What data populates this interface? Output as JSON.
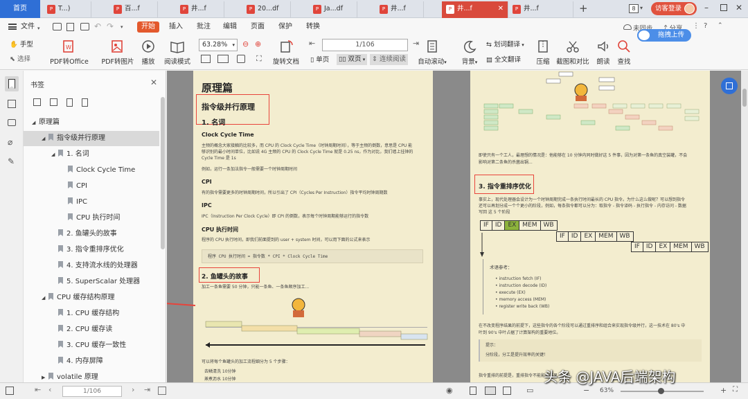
{
  "tabs": {
    "home": "首页",
    "docs": [
      {
        "label": "T...)"
      },
      {
        "label": "百...f"
      },
      {
        "label": "井...f"
      },
      {
        "label": "20...df"
      },
      {
        "label": "Ja...df"
      },
      {
        "label": "井...f"
      },
      {
        "label": "井...f",
        "active": true
      },
      {
        "label": "井...f"
      }
    ],
    "page_count_badge": "8",
    "login": "访客登录"
  },
  "menu": {
    "file": "文件",
    "start": "开始",
    "insert": "插入",
    "annotate": "批注",
    "edit": "编辑",
    "page": "页面",
    "protect": "保护",
    "convert": "转换",
    "sync": "未同步",
    "share": "分享"
  },
  "toolbar": {
    "hand": "手型",
    "select": "选择",
    "pdf_to_office": "PDF转Office",
    "pdf_to_image": "PDF转图片",
    "play": "播放",
    "read_mode": "阅读模式",
    "zoom": "63.28%",
    "rotate": "旋转文档",
    "page_value": "1/106",
    "single": "单页",
    "double": "双页",
    "continuous": "连续阅读",
    "auto_scroll": "自动滚动",
    "background": "背景",
    "word_translate": "划词翻译",
    "full_translate": "全文翻译",
    "compress": "压缩",
    "crop_compare": "截图和对比",
    "read_aloud": "朗读",
    "find": "查找",
    "upload": "拖拽上传"
  },
  "sidebar": {
    "title": "书签",
    "items": [
      {
        "label": "原理篇",
        "level": 0,
        "expanded": true
      },
      {
        "label": "指令级并行原理",
        "level": 1,
        "expanded": true,
        "selected": true
      },
      {
        "label": "1. 名词",
        "level": 2,
        "expanded": true
      },
      {
        "label": "Clock Cycle Time",
        "level": 3
      },
      {
        "label": "CPI",
        "level": 3
      },
      {
        "label": "IPC",
        "level": 3
      },
      {
        "label": "CPU 执行时间",
        "level": 3
      },
      {
        "label": "2. 鱼罐头的故事",
        "level": 2
      },
      {
        "label": "3. 指令重排序优化",
        "level": 2
      },
      {
        "label": "4. 支持流水线的处理器",
        "level": 2
      },
      {
        "label": "5. SuperScalar 处理器",
        "level": 2
      },
      {
        "label": "CPU 缓存结构原理",
        "level": 1,
        "expanded": true
      },
      {
        "label": "1. CPU 缓存结构",
        "level": 2
      },
      {
        "label": "2. CPU 缓存读",
        "level": 2
      },
      {
        "label": "3. CPU 缓存一致性",
        "level": 2
      },
      {
        "label": "4. 内存屏障",
        "level": 2
      },
      {
        "label": "volatile 原理",
        "level": 1,
        "expanded": false
      }
    ]
  },
  "page1": {
    "title": "原理篇",
    "h1": "指令级并行原理",
    "h2_terms": "1. 名词",
    "h3_clock": "Clock Cycle Time",
    "p_clock": "主频的概念大家接触的比较多，而 CPU 的 Clock Cycle Time（时钟周期时间），等于主频的倒数，意思是 CPU 能",
    "p_clock2": "够识别的最小时间单位，比如说 4G 主频的 CPU 的 Clock Cycle Time 就是 0.25 ns，作为对比，我们墙上挂钟的",
    "p_clock3": "Cycle Time 是 1s",
    "p_example": "例如，运行一条加法指令一般需要一个时钟周期时间",
    "h3_cpi": "CPI",
    "p_cpi": "有的指令需要更多的时钟周期时间，所以引出了 CPI（Cycles Per Instruction）指令平均时钟周期数",
    "h3_ipc": "IPC",
    "p_ipc": "IPC（Instruction Per Clock Cycle）即 CPI 的倒数，表示每个时钟周期能够运行的指令数",
    "h3_exec": "CPU 执行时间",
    "p_exec": "程序的 CPU 执行时间，即我们前面提到的 user + system 时间，可以用下面的公式来表示",
    "code": "程序 CPU 执行时间 = 指令数 * CPI * Clock Cycle Time",
    "h2_fish": "2. 鱼罐头的故事",
    "p_fish": "加工一条鱼需要 50 分钟，只能一条鱼、一条鱼顺序加工...",
    "p_fish2": "可以将每个鱼罐头的加工流程细分为 5 个步骤：",
    "li1": "去鳞清洗 10分钟",
    "li2": "蒸煮沥水 10分钟"
  },
  "page2": {
    "p_intro": "即使只有一个工人，最理想的情况是：他能够在 10 分钟内同时做好这 5 件事，因为对第一条鱼的真空装罐，不会",
    "p_intro2": "影响对第二条鱼的杀菌出锅...",
    "h2_reorder": "3. 指令重排序优化",
    "p_reorder": "事实上，现代处理器会设计为一个时钟周期完成一条执行时间最长的 CPU 指令。为什么这么做呢？可以想到指令",
    "p_reorder2": "还可以再划分成一个个更小的阶段，例如，每条指令都可以分为：取指令 - 指令译码 - 执行指令 - 内存访问 - 数据",
    "p_reorder3": "写回 这 5 个阶段",
    "stages": [
      "IF",
      "ID",
      "EX",
      "MEM",
      "WB"
    ],
    "ref_title": "术语参考：",
    "refs": [
      "instruction fetch (IF)",
      "instruction decode (ID)",
      "execute (EX)",
      "memory access (MEM)",
      "register write back (WB)"
    ],
    "p_after": "在不改变程序结果的前提下，这些指令的各个阶段可以通过重排序和组合来实现指令级并行，这一技术在 80's 中",
    "p_after2": "叶到 90's 中叶占据了计算架构的重要地位。",
    "tip_title": "提示：",
    "tip": "分阶段，分工是提升效率的关键！",
    "p_bottom": "指令重排的前提是，重排指令不能影响结果，例如"
  },
  "status": {
    "page_value": "1/106",
    "zoom": "63%"
  },
  "watermark": "头条 @JAVA后端架构",
  "colors": {
    "accent": "#e3592d",
    "home_tab": "#2f6fd6",
    "active_tab": "#d94a3c",
    "annotation_red": "#e8433a",
    "page_bg": "#f3edcf"
  }
}
